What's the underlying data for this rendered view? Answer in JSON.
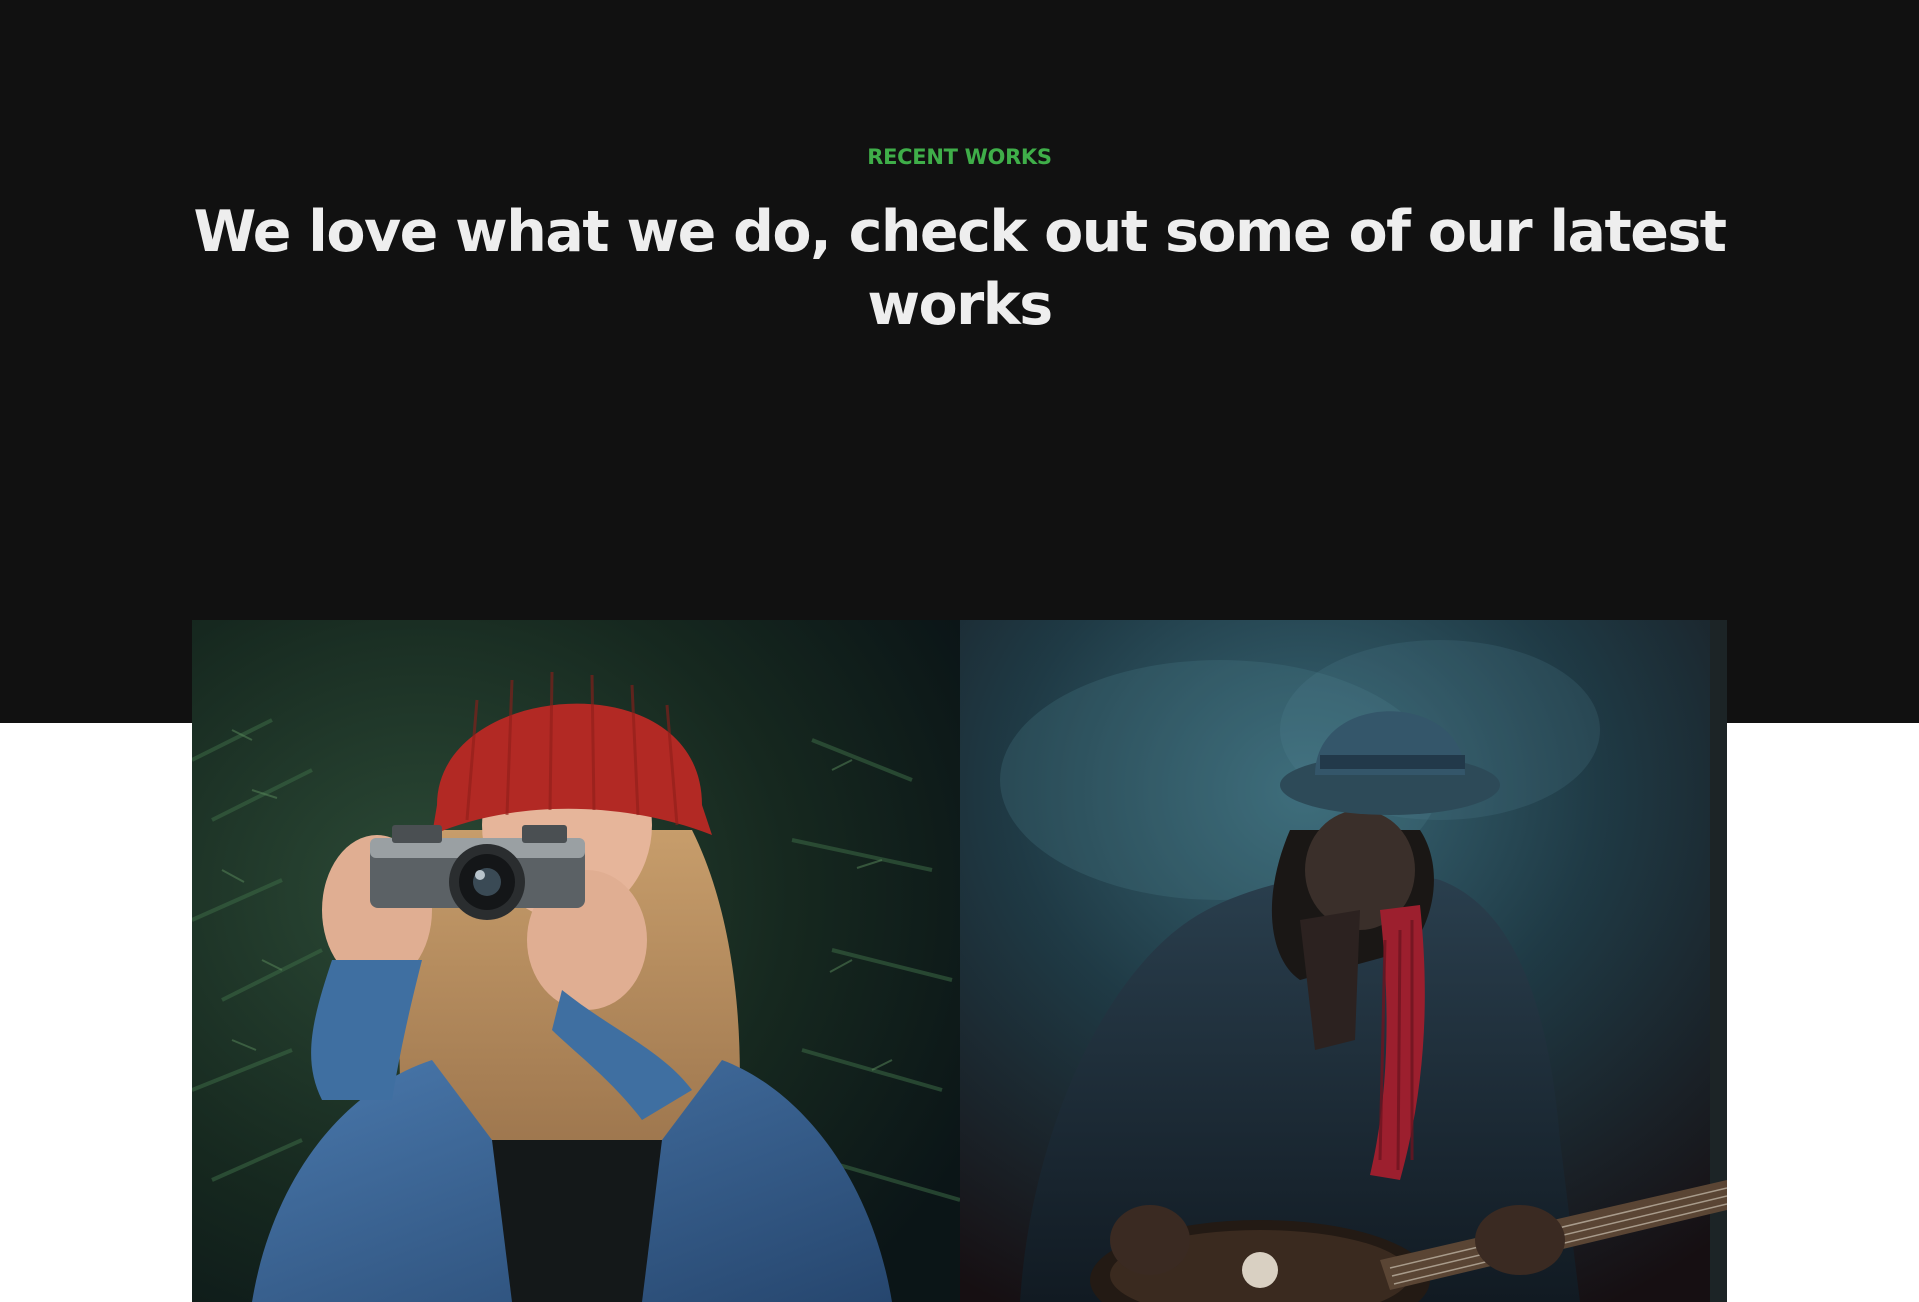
{
  "section": {
    "eyebrow": "RECENT WORKS",
    "headline": "We love what we do, check out some of our latest works"
  },
  "works": [
    {
      "subject": "photographer-photo"
    },
    {
      "subject": "guitarist-photo"
    }
  ],
  "colors": {
    "background_dark": "#111111",
    "background_light": "#ffffff",
    "accent": "#3fae49",
    "headline": "#eeeeee"
  }
}
